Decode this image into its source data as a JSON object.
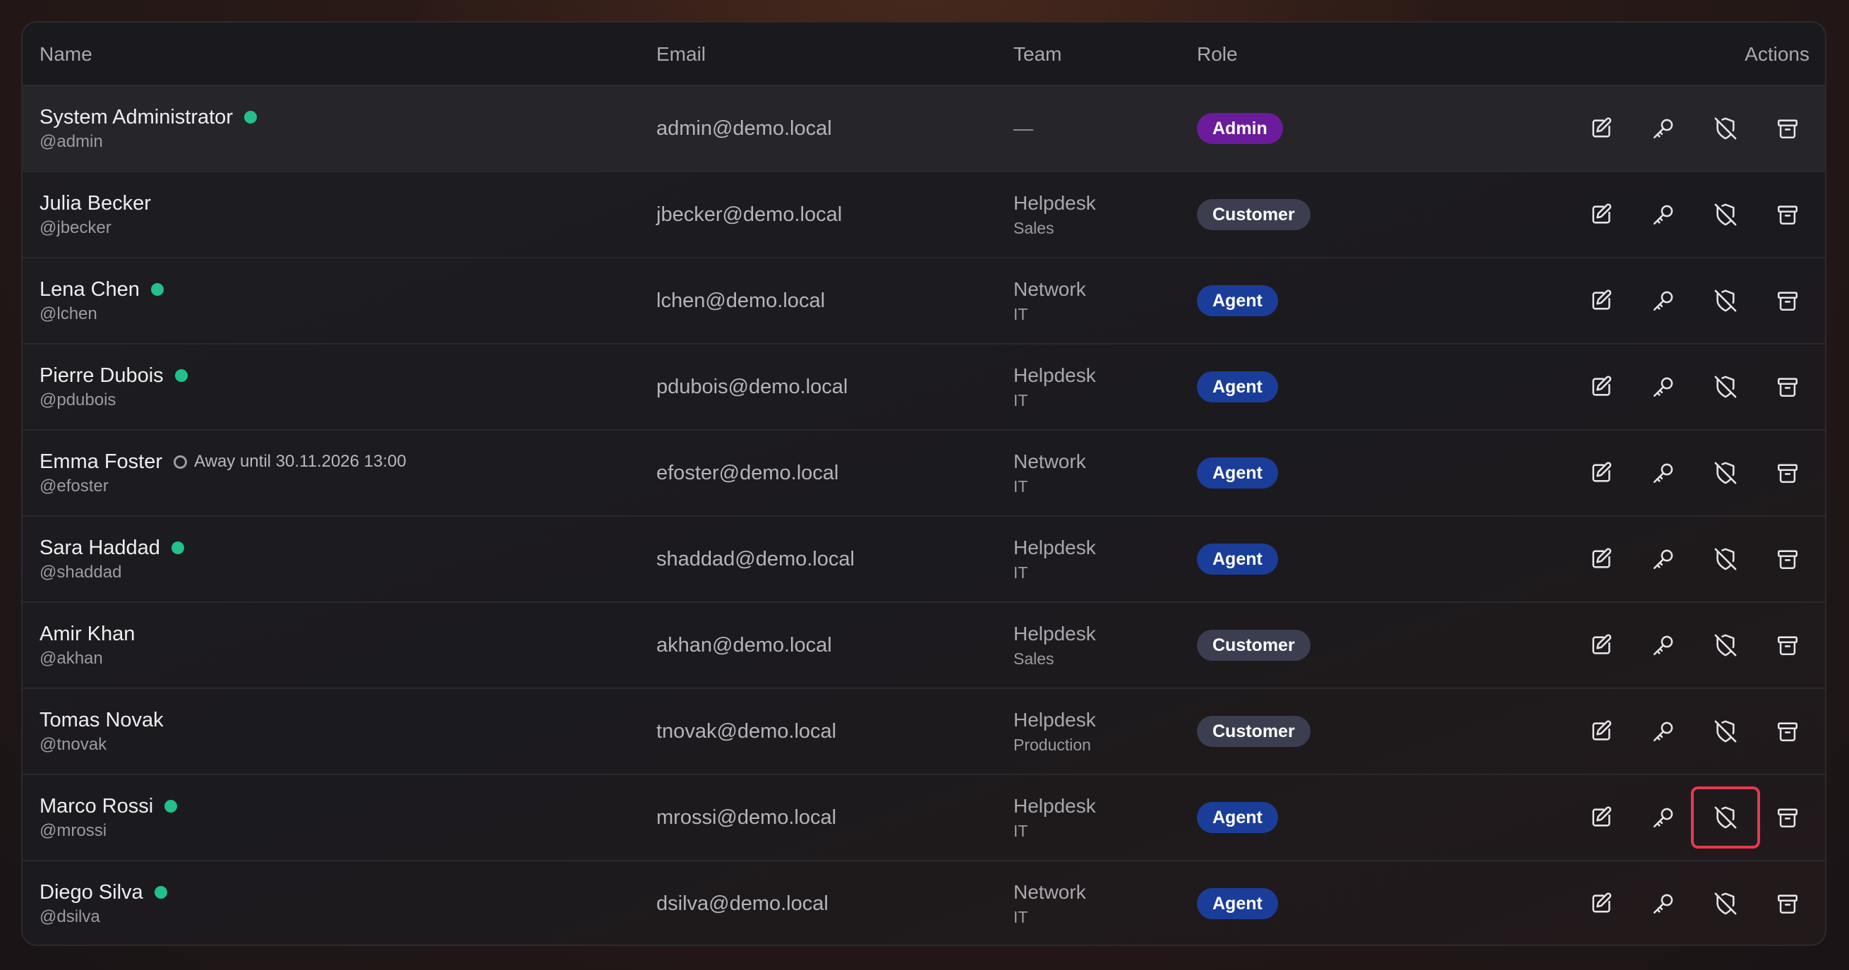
{
  "colors": {
    "admin_badge": "#6a1c9c",
    "customer_badge": "#3a3e4e",
    "agent_badge": "#1b3d9a",
    "online_dot": "#22c08a",
    "focus_ring": "#e23a4e"
  },
  "table": {
    "headers": {
      "name": "Name",
      "email": "Email",
      "team": "Team",
      "role": "Role",
      "actions": "Actions"
    },
    "actions_icons": [
      "edit-icon",
      "key-icon",
      "shield-off-icon",
      "archive-icon"
    ],
    "rows": [
      {
        "name": "System Administrator",
        "handle": "@admin",
        "status": "online",
        "away": "",
        "email": "admin@demo.local",
        "team": "—",
        "subteam": "",
        "role": "Admin",
        "role_type": "admin"
      },
      {
        "name": "Julia Becker",
        "handle": "@jbecker",
        "status": "none",
        "away": "",
        "email": "jbecker@demo.local",
        "team": "Helpdesk",
        "subteam": "Sales",
        "role": "Customer",
        "role_type": "customer"
      },
      {
        "name": "Lena Chen",
        "handle": "@lchen",
        "status": "online",
        "away": "",
        "email": "lchen@demo.local",
        "team": "Network",
        "subteam": "IT",
        "role": "Agent",
        "role_type": "agent"
      },
      {
        "name": "Pierre Dubois",
        "handle": "@pdubois",
        "status": "online",
        "away": "",
        "email": "pdubois@demo.local",
        "team": "Helpdesk",
        "subteam": "IT",
        "role": "Agent",
        "role_type": "agent"
      },
      {
        "name": "Emma Foster",
        "handle": "@efoster",
        "status": "away",
        "away": "Away  until 30.11.2026 13:00",
        "email": "efoster@demo.local",
        "team": "Network",
        "subteam": "IT",
        "role": "Agent",
        "role_type": "agent"
      },
      {
        "name": "Sara Haddad",
        "handle": "@shaddad",
        "status": "online",
        "away": "",
        "email": "shaddad@demo.local",
        "team": "Helpdesk",
        "subteam": "IT",
        "role": "Agent",
        "role_type": "agent"
      },
      {
        "name": "Amir Khan",
        "handle": "@akhan",
        "status": "none",
        "away": "",
        "email": "akhan@demo.local",
        "team": "Helpdesk",
        "subteam": "Sales",
        "role": "Customer",
        "role_type": "customer"
      },
      {
        "name": "Tomas Novak",
        "handle": "@tnovak",
        "status": "none",
        "away": "",
        "email": "tnovak@demo.local",
        "team": "Helpdesk",
        "subteam": "Production",
        "role": "Customer",
        "role_type": "customer"
      },
      {
        "name": "Marco Rossi",
        "handle": "@mrossi",
        "status": "online",
        "away": "",
        "email": "mrossi@demo.local",
        "team": "Helpdesk",
        "subteam": "IT",
        "role": "Agent",
        "role_type": "agent",
        "focused_action": "shield-off-icon"
      },
      {
        "name": "Diego Silva",
        "handle": "@dsilva",
        "status": "online",
        "away": "",
        "email": "dsilva@demo.local",
        "team": "Network",
        "subteam": "IT",
        "role": "Agent",
        "role_type": "agent"
      }
    ]
  }
}
